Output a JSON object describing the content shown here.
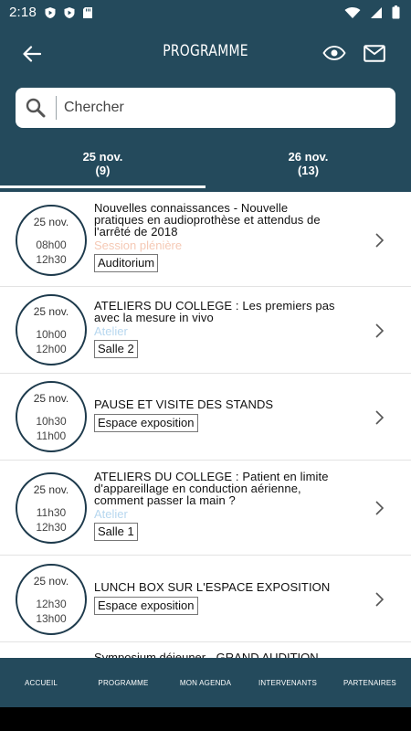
{
  "status_bar": {
    "time": "2:18"
  },
  "header": {
    "title": "PROGRAMME"
  },
  "search": {
    "placeholder": "Chercher"
  },
  "tabs": [
    {
      "date": "25 nov.",
      "count": "(9)"
    },
    {
      "date": "26 nov.",
      "count": "(13)"
    }
  ],
  "colors": {
    "header_bg": "#244a5c",
    "pleniere": "#f5c9b5",
    "atelier": "#b7d7ef"
  },
  "sessions": [
    {
      "date": "25 nov.",
      "start": "08h00",
      "end": "12h30",
      "title_lines": [
        "Nouvelles connaissances - Nouvelle",
        "pratiques en audioprothèse et attendus de",
        "l'arrêté de 2018"
      ],
      "category": "Session plénière",
      "category_color": "#f5c9b5",
      "room": "Auditorium"
    },
    {
      "date": "25 nov.",
      "start": "10h00",
      "end": "12h00",
      "title_lines": [
        "ATELIERS DU COLLEGE : Les premiers pas",
        "avec la mesure in vivo"
      ],
      "category": "Atelier",
      "category_color": "#b7d7ef",
      "room": "Salle 2"
    },
    {
      "date": "25 nov.",
      "start": "10h30",
      "end": "11h00",
      "title_lines": [
        "PAUSE ET VISITE DES STANDS"
      ],
      "category": "",
      "category_color": "",
      "room": "Espace exposition"
    },
    {
      "date": "25 nov.",
      "start": "11h30",
      "end": "12h30",
      "title_lines": [
        "ATELIERS DU COLLEGE : Patient en limite",
        "d'appareillage en conduction aérienne,",
        "comment passer la main ?"
      ],
      "category": "Atelier",
      "category_color": "#b7d7ef",
      "room": "Salle 1"
    },
    {
      "date": "25 nov.",
      "start": "12h30",
      "end": "13h00",
      "title_lines": [
        "LUNCH BOX SUR L'ESPACE EXPOSITION"
      ],
      "category": "",
      "category_color": "",
      "room": "Espace exposition"
    }
  ],
  "partial_next_title": "Symposium déjeuner - GRAND AUDITION",
  "bottom_nav": [
    "ACCUEIL",
    "PROGRAMME",
    "MON AGENDA",
    "INTERVENANTS",
    "PARTENAIRES"
  ]
}
